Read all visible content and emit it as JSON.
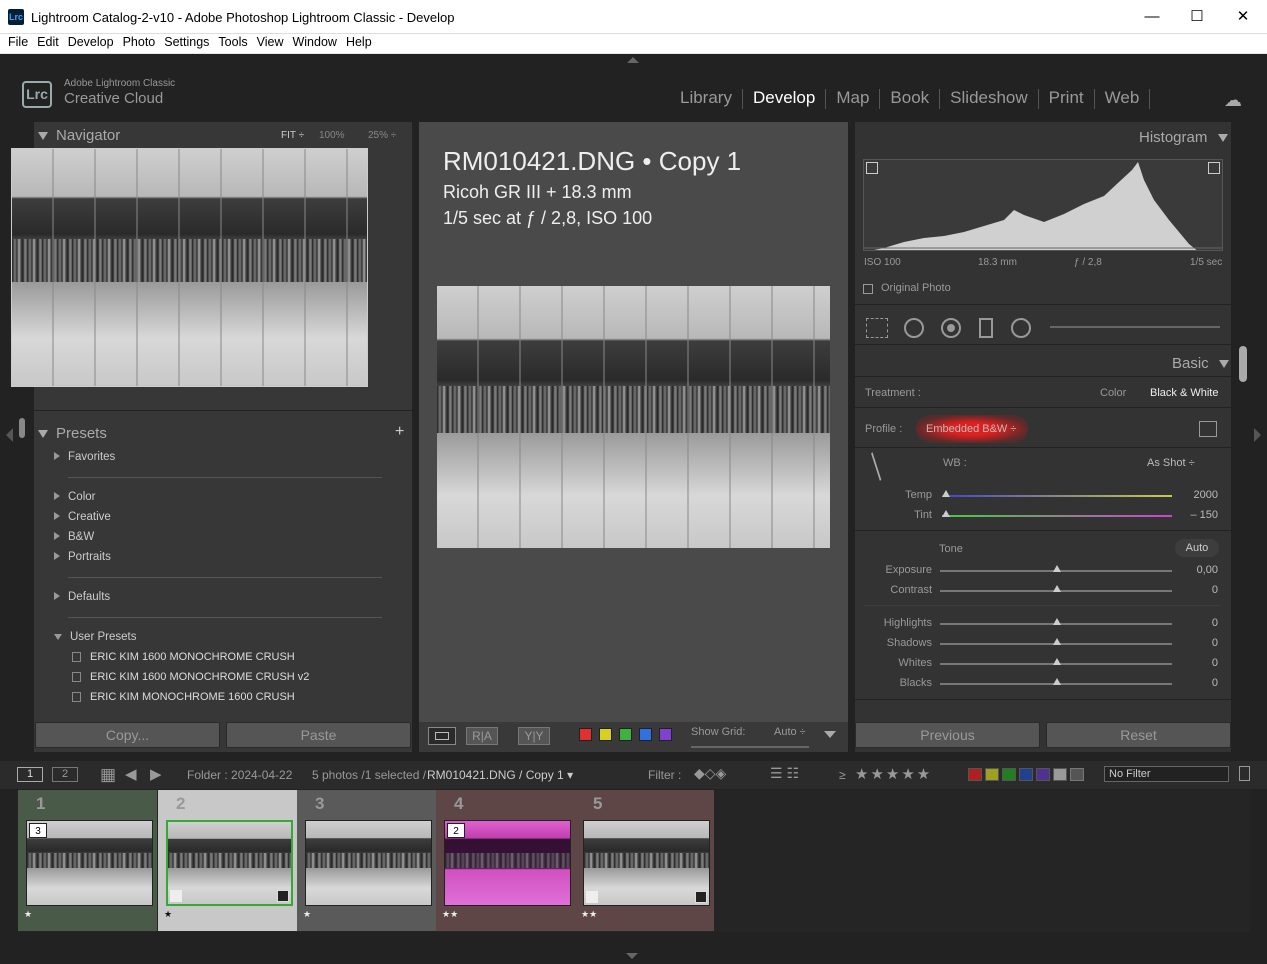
{
  "window": {
    "title": "Lightroom Catalog-2-v10 - Adobe Photoshop Lightroom Classic - Develop",
    "app_icon": "Lrc",
    "minimize": "—",
    "maximize": "☐",
    "close": "✕"
  },
  "menu": [
    "File",
    "Edit",
    "Develop",
    "Photo",
    "Settings",
    "Tools",
    "View",
    "Window",
    "Help"
  ],
  "identity": {
    "badge": "Lrc",
    "line1": "Adobe Lightroom Classic",
    "line2": "Creative Cloud"
  },
  "modules": [
    "Library",
    "Develop",
    "Map",
    "Book",
    "Slideshow",
    "Print",
    "Web"
  ],
  "active_module": "Develop",
  "navigator": {
    "title": "Navigator",
    "fit": "FIT ÷",
    "zoom1": "100%",
    "zoom2": "25% ÷"
  },
  "presets": {
    "title": "Presets",
    "add": "+",
    "groups": [
      "Favorites",
      "Color",
      "Creative",
      "B&W",
      "Portraits",
      "Defaults",
      "User Presets"
    ],
    "user_presets": [
      "ERIC KIM 1600 MONOCHROME CRUSH",
      "ERIC KIM 1600 MONOCHROME CRUSH v2",
      "ERIC KIM MONOCHROME 1600 CRUSH"
    ]
  },
  "left_buttons": {
    "copy": "Copy...",
    "paste": "Paste"
  },
  "photo_info": {
    "line1": "RM010421.DNG  •  Copy 1",
    "line2": "Ricoh GR III + 18.3 mm",
    "line3": "1/5 sec at ƒ / 2,8, ISO 100"
  },
  "toolbar": {
    "ra": "R|A",
    "yy": "Y|Y",
    "show_grid": "Show Grid:",
    "auto": "Auto ÷"
  },
  "color_labels": [
    "#e03030",
    "#d8d020",
    "#40b040",
    "#3070e0",
    "#8040d0"
  ],
  "histogram": {
    "title": "Histogram",
    "iso": "ISO 100",
    "focal": "18.3 mm",
    "aperture": "ƒ / 2,8",
    "shutter": "1/5 sec",
    "original": "Original Photo"
  },
  "basic": {
    "title": "Basic",
    "treatment_label": "Treatment :",
    "treatment_color": "Color",
    "treatment_bw": "Black & White",
    "profile_label": "Profile :",
    "profile_value": "Embedded B&W ÷",
    "wb_label": "WB :",
    "wb_value": "As Shot ÷",
    "temp_label": "Temp",
    "temp_value": "2000",
    "tint_label": "Tint",
    "tint_value": "– 150",
    "tone_label": "Tone",
    "auto": "Auto",
    "sliders": [
      {
        "label": "Exposure",
        "value": "0,00"
      },
      {
        "label": "Contrast",
        "value": "0"
      },
      {
        "label": "Highlights",
        "value": "0"
      },
      {
        "label": "Shadows",
        "value": "0"
      },
      {
        "label": "Whites",
        "value": "0"
      },
      {
        "label": "Blacks",
        "value": "0"
      }
    ]
  },
  "right_buttons": {
    "previous": "Previous",
    "reset": "Reset"
  },
  "filmbar": {
    "view1": "1",
    "view2": "2",
    "folder": "Folder : 2024-04-22",
    "count": "5 photos /1 selected /",
    "file": "RM010421.DNG / Copy 1 ▾",
    "filter": "Filter :",
    "ge": "≥",
    "stars": "★★★★★",
    "no_filter": "No Filter"
  },
  "filmstrip": [
    {
      "num": "1",
      "stars": "★",
      "badge": "3",
      "bg": "#4a5a48"
    },
    {
      "num": "2",
      "stars": "★",
      "badge": "",
      "bg": "#c8c8c8"
    },
    {
      "num": "3",
      "stars": "★",
      "badge": "",
      "bg": "#5a5a5a"
    },
    {
      "num": "4",
      "stars": "★★",
      "badge": "2",
      "bg": "#5e4646"
    },
    {
      "num": "5",
      "stars": "★★",
      "badge": "",
      "bg": "#5e4646"
    }
  ]
}
